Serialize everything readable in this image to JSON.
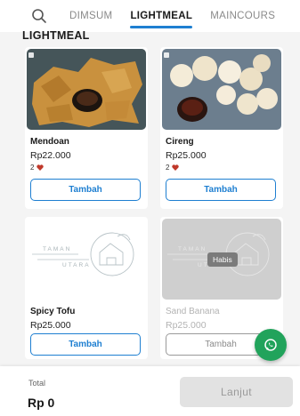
{
  "header": {
    "search_icon": "search-icon",
    "tabs": [
      {
        "label": "DIMSUM",
        "active": false
      },
      {
        "label": "LIGHTMEAL",
        "active": true
      },
      {
        "label": "MAINCOURS",
        "active": false
      }
    ]
  },
  "section": {
    "title": "LIGHTMEAL"
  },
  "products": [
    {
      "name": "Mendoan",
      "price": "Rp22.000",
      "likes": "2",
      "button": "Tambah",
      "sold_out": false
    },
    {
      "name": "Cireng",
      "price": "Rp25.000",
      "likes": "2",
      "button": "Tambah",
      "sold_out": false
    },
    {
      "name": "Spicy Tofu",
      "price": "Rp25.000",
      "button": "Tambah",
      "sold_out": false,
      "image_text": [
        "TAMAN",
        "UTARA"
      ]
    },
    {
      "name": "Sand Banana",
      "price": "Rp25.000",
      "button": "Tambah",
      "sold_out": true,
      "status_badge": "Habis",
      "image_text": [
        "TAMAN",
        "UTARA"
      ]
    }
  ],
  "fab": {
    "icon": "whatsapp-icon"
  },
  "footer": {
    "total_label": "Total",
    "total_value": "Rp 0",
    "continue_label": "Lanjut"
  },
  "colors": {
    "accent": "#1e7fd1",
    "whatsapp": "#21a35b",
    "like": "#c0392b"
  }
}
